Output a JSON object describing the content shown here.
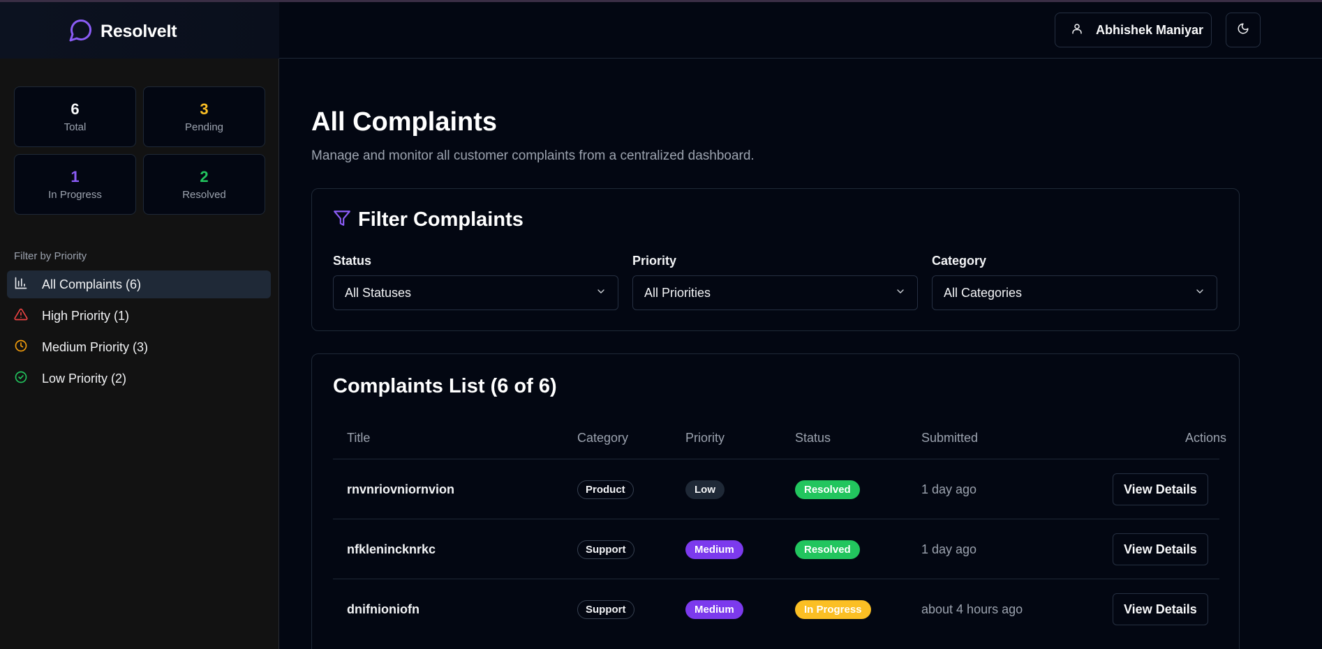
{
  "header": {
    "brand_name": "ResolveIt",
    "user_name": "Abhishek Maniyar",
    "icons": {
      "logo": "chat-bubble-icon",
      "user": "user-icon",
      "theme": "moon-icon"
    }
  },
  "sidebar": {
    "stats": [
      {
        "value": "6",
        "label": "Total",
        "color": "#f9fafb"
      },
      {
        "value": "3",
        "label": "Pending",
        "color": "#fbbf24"
      },
      {
        "value": "1",
        "label": "In Progress",
        "color": "#8b5cf6"
      },
      {
        "value": "2",
        "label": "Resolved",
        "color": "#22c55e"
      }
    ],
    "filter_title": "Filter by Priority",
    "items": [
      {
        "label": "All Complaints (6)",
        "icon": "bar-chart-icon",
        "active": true
      },
      {
        "label": "High Priority (1)",
        "icon": "alert-triangle-icon",
        "color": "#ef4444"
      },
      {
        "label": "Medium Priority (3)",
        "icon": "clock-icon",
        "color": "#f59e0b"
      },
      {
        "label": "Low Priority (2)",
        "icon": "check-circle-icon",
        "color": "#22c55e"
      }
    ]
  },
  "main": {
    "title": "All Complaints",
    "subtitle": "Manage and monitor all customer complaints from a centralized dashboard.",
    "filters": {
      "title": "Filter Complaints",
      "fields": [
        {
          "label": "Status",
          "value": "All Statuses"
        },
        {
          "label": "Priority",
          "value": "All Priorities"
        },
        {
          "label": "Category",
          "value": "All Categories"
        }
      ]
    },
    "list": {
      "title": "Complaints List (6 of 6)",
      "columns": [
        "Title",
        "Category",
        "Priority",
        "Status",
        "Submitted",
        "Actions"
      ],
      "rows": [
        {
          "title": "rnvnriovniornvion",
          "category": "Product",
          "priority": "Low",
          "status": "Resolved",
          "submitted": "1 day ago",
          "action": "View Details"
        },
        {
          "title": "nfklenincknrkc",
          "category": "Support",
          "priority": "Medium",
          "status": "Resolved",
          "submitted": "1 day ago",
          "action": "View Details"
        },
        {
          "title": "dnifnioniofn",
          "category": "Support",
          "priority": "Medium",
          "status": "In Progress",
          "submitted": "about 4 hours ago",
          "action": "View Details"
        }
      ]
    }
  },
  "colors": {
    "accent": "#8b5cf6",
    "priority_low_bg": "#1f2937",
    "priority_medium_bg": "#7c3aed",
    "status_resolved_bg": "#22c55e",
    "status_in_progress_bg": "#fbbf24"
  }
}
